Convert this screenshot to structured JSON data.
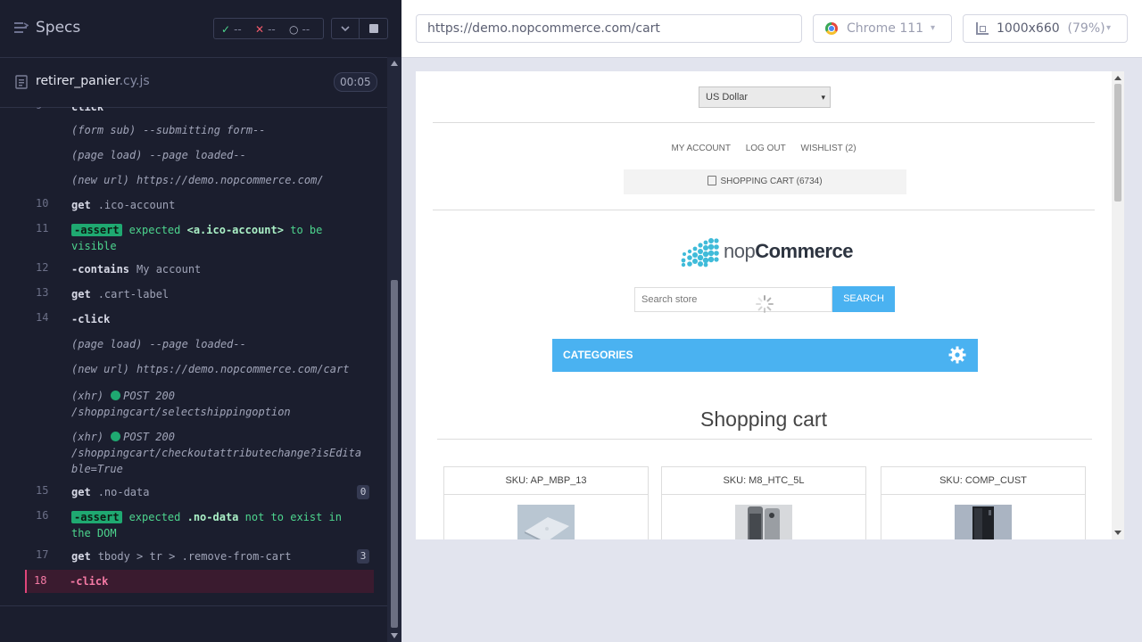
{
  "left_panel": {
    "title": "Specs",
    "stats": {
      "passed": "--",
      "failed": "--",
      "pending": "--"
    },
    "file": {
      "name": "retirer_panier",
      "ext": ".cy.js",
      "duration": "00:05"
    },
    "log": [
      {
        "id": "r0",
        "num": "",
        "kind": "cut",
        "text": "click"
      },
      {
        "id": "r1",
        "num": "",
        "kind": "event",
        "event": "(form sub)",
        "text": "--submitting form--"
      },
      {
        "id": "r2",
        "num": "",
        "kind": "event",
        "event": "(page load)",
        "text": "--page loaded--"
      },
      {
        "id": "r3",
        "num": "",
        "kind": "event",
        "event": "(new url)",
        "text": "https://demo.nopcommerce.com/"
      },
      {
        "id": "r4",
        "num": "10",
        "kind": "cmd",
        "name": "get",
        "arg": ".ico-account"
      },
      {
        "id": "r5",
        "num": "11",
        "kind": "assert",
        "name": "-assert",
        "pre": "expected",
        "subject": "<a.ico-account>",
        "post": "to be visible"
      },
      {
        "id": "r6",
        "num": "12",
        "kind": "cmd",
        "name": "-contains",
        "arg": "My account"
      },
      {
        "id": "r7",
        "num": "13",
        "kind": "cmd",
        "name": "get",
        "arg": ".cart-label"
      },
      {
        "id": "r8",
        "num": "14",
        "kind": "cmd",
        "name": "-click",
        "arg": ""
      },
      {
        "id": "r9",
        "num": "",
        "kind": "event",
        "event": "(page load)",
        "text": "--page loaded--"
      },
      {
        "id": "r10",
        "num": "",
        "kind": "event",
        "event": "(new url)",
        "text": "https://demo.nopcommerce.com/cart"
      },
      {
        "id": "r11",
        "num": "",
        "kind": "xhr",
        "event": "(xhr)",
        "method": "POST 200",
        "path": "/shoppingcart/selectshippingoption"
      },
      {
        "id": "r12",
        "num": "",
        "kind": "xhr",
        "event": "(xhr)",
        "method": "POST 200",
        "path": "/shoppingcart/checkoutattributechange?isEditable=True"
      },
      {
        "id": "r13",
        "num": "15",
        "kind": "cmd",
        "name": "get",
        "arg": ".no-data",
        "count": "0"
      },
      {
        "id": "r14",
        "num": "16",
        "kind": "assert",
        "name": "-assert",
        "pre": "expected",
        "subject": ".no-data",
        "post": "not to exist in the DOM"
      },
      {
        "id": "r15",
        "num": "17",
        "kind": "cmd",
        "name": "get",
        "arg": "tbody > tr > .remove-from-cart",
        "count": "3"
      },
      {
        "id": "r16",
        "num": "18",
        "kind": "cmd",
        "name": "-click",
        "arg": ""
      }
    ]
  },
  "toolbar": {
    "url": "https://demo.nopcommerce.com/cart",
    "browser": "Chrome 111",
    "viewport": "1000x660",
    "viewport_zoom": "(79%)"
  },
  "site": {
    "currency": "US Dollar",
    "header_links": [
      "MY ACCOUNT",
      "LOG OUT",
      "WISHLIST (2)"
    ],
    "cart_link": "SHOPPING CART (6734)",
    "logo_text_light": "nop",
    "logo_text_bold": "Commerce",
    "search_placeholder": "Search store",
    "search_button": "SEARCH",
    "categories": "CATEGORIES",
    "page_title": "Shopping cart",
    "items": [
      {
        "sku": "SKU: AP_MBP_13",
        "image": "laptop-image"
      },
      {
        "sku": "SKU: M8_HTC_5L",
        "image": "phone-image"
      },
      {
        "sku": "SKU: COMP_CUST",
        "image": "pc-tower-image"
      }
    ]
  },
  "colors": {
    "accent": "#4ab2f1",
    "pass": "#4dd58e",
    "fail": "#f15a6b",
    "active_row": "#3a1b2f"
  }
}
